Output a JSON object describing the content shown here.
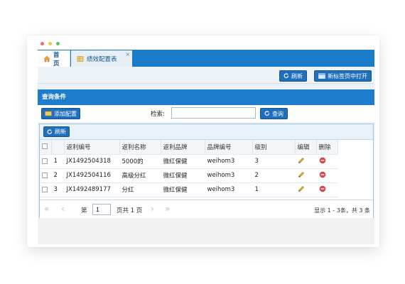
{
  "tabs": {
    "home_label": "首页",
    "active_label": "绩效配置表",
    "close_symbol": "×"
  },
  "toolbar": {
    "refresh_label": "刷新",
    "open_new_tab_label": "新标签页中打开"
  },
  "query_section": {
    "title": "查询条件",
    "add_button_label": "添加配置",
    "search_label": "检索:",
    "search_value": "",
    "query_button_label": "查询"
  },
  "grid": {
    "refresh_label": "刷新",
    "columns": [
      "返利编号",
      "返利名称",
      "返利品牌",
      "品牌编号",
      "级别",
      "编辑",
      "删除"
    ],
    "rows": [
      {
        "num": "1",
        "id": "JX1492504318",
        "name": "5000的",
        "brand": "微红保健",
        "brand_code": "weihom3",
        "level": "3"
      },
      {
        "num": "2",
        "id": "JX1492504116",
        "name": "高级分红",
        "brand": "微红保健",
        "brand_code": "weihom3",
        "level": "2"
      },
      {
        "num": "3",
        "id": "JX1492489177",
        "name": "分红",
        "brand": "微红保健",
        "brand_code": "weihom3",
        "level": "1"
      }
    ]
  },
  "pager": {
    "page_prefix": "第",
    "page_value": "1",
    "page_suffix": "页共 1 页",
    "info": "显示 1 - 3条，共 3 条"
  },
  "colors": {
    "primary": "#1d7dcc",
    "button": "#1f6fbd",
    "dot_red": "#f26b5f",
    "dot_yellow": "#f5c150",
    "dot_green": "#5cc363"
  }
}
